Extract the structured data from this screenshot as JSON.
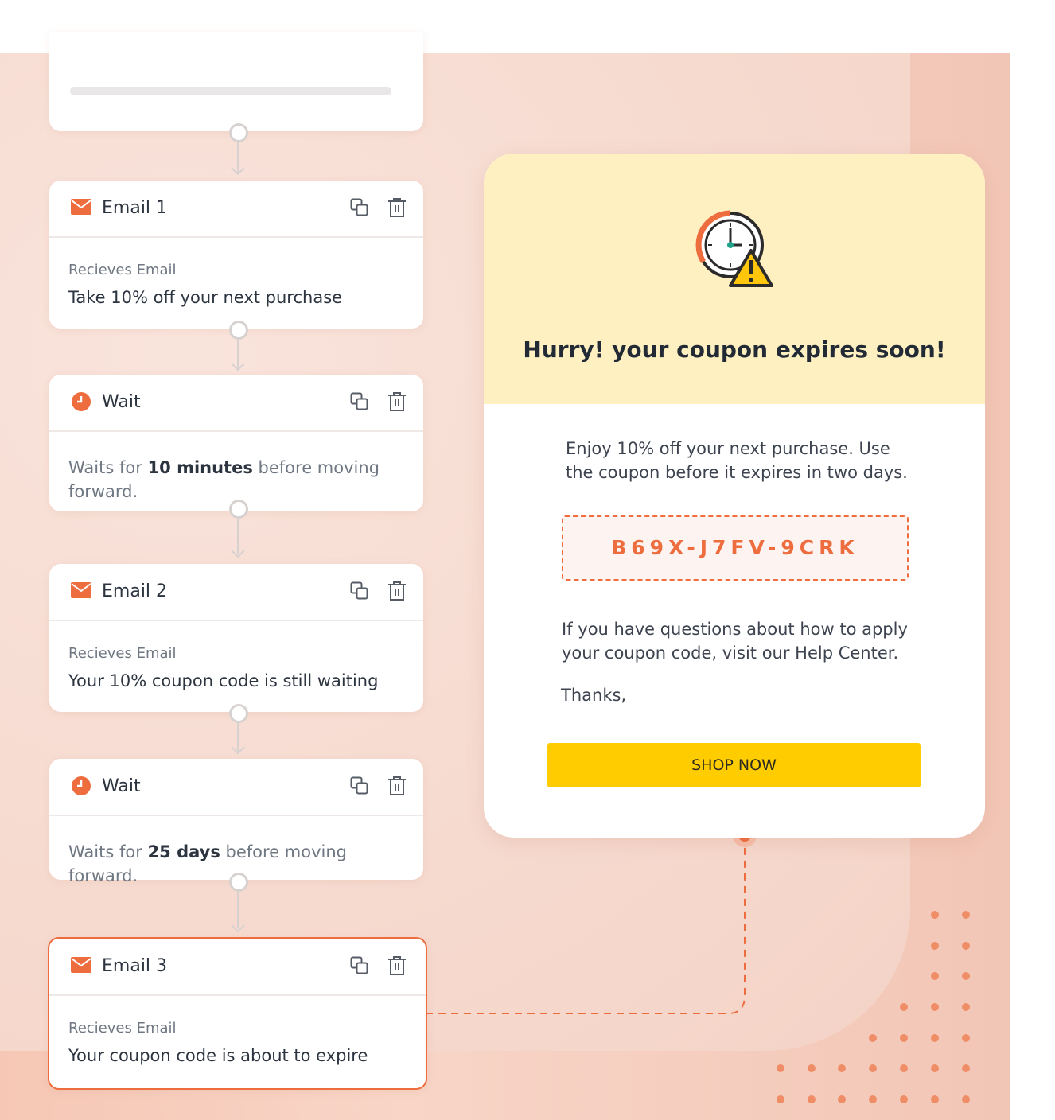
{
  "flow": {
    "steps": [
      {
        "type": "placeholder"
      },
      {
        "type": "email",
        "title": "Email 1",
        "label": "Recieves Email",
        "subject": "Take 10% off your next purchase"
      },
      {
        "type": "wait",
        "title": "Wait",
        "prefix": "Waits for",
        "amount": "10 minutes",
        "suffix": "before moving",
        "suffix2": "forward."
      },
      {
        "type": "email",
        "title": "Email 2",
        "label": "Recieves Email",
        "subject": "Your 10% coupon code is still waiting"
      },
      {
        "type": "wait",
        "title": "Wait",
        "prefix": "Waits for",
        "amount": "25 days",
        "suffix": "before moving forward."
      },
      {
        "type": "email",
        "title": "Email 3",
        "label": "Recieves Email",
        "subject": "Your coupon code is about to expire",
        "active": true
      }
    ],
    "icons": {
      "email": "envelope-icon",
      "wait": "clock-icon",
      "copy": "copy-icon",
      "delete": "trash-icon"
    }
  },
  "email_preview": {
    "headline": "Hurry! your coupon expires soon!",
    "hero_icon": "clock-warning-icon",
    "intro_line1": "Enjoy 10% off your next purchase. Use",
    "intro_line2": "the coupon before it expires in two days.",
    "coupon_code": "B69X-J7FV-9CRK",
    "help_line1": "If you have questions about how to apply",
    "help_line2": "your coupon code, visit our Help Center.",
    "signoff": "Thanks,",
    "cta": "SHOP NOW"
  },
  "colors": {
    "accent": "#ee6d3f",
    "cta": "#ffcc00",
    "header_bg": "#fff0c2",
    "background": "#f6c7b5"
  }
}
